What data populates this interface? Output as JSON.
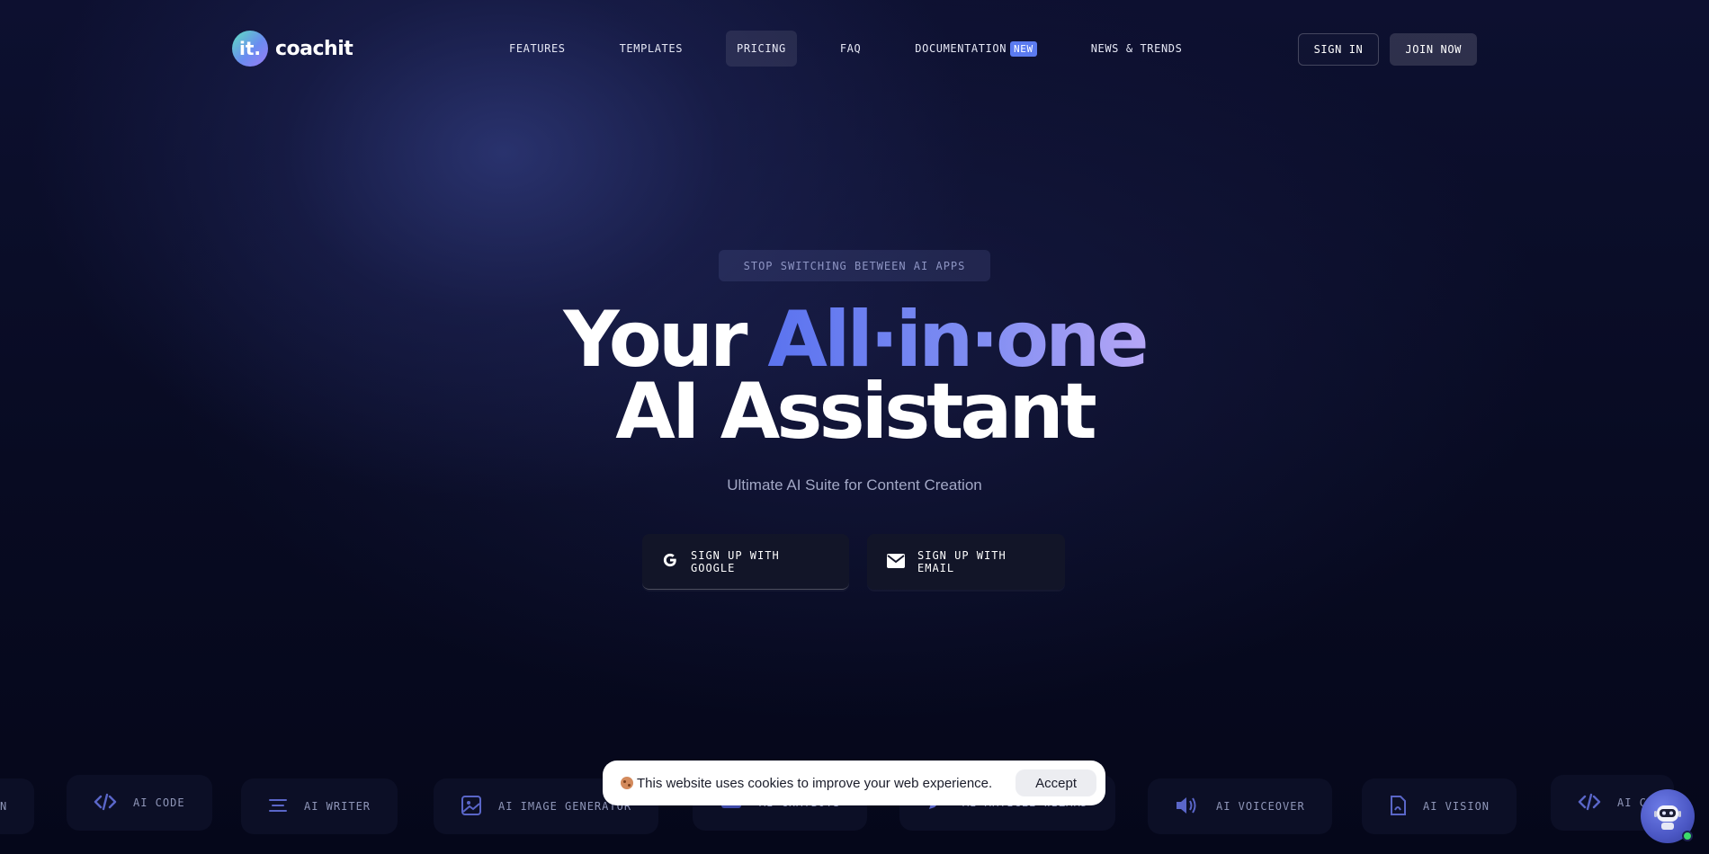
{
  "brand": {
    "logo_mark": "it.",
    "name": "coachit"
  },
  "nav": {
    "items": [
      {
        "label": "FEATURES"
      },
      {
        "label": "TEMPLATES"
      },
      {
        "label": "PRICING",
        "active": true
      },
      {
        "label": "FAQ"
      },
      {
        "label": "DOCUMENTATION",
        "badge": "NEW"
      },
      {
        "label": "NEWS & TRENDS"
      }
    ],
    "sign_in": "SIGN IN",
    "join_now": "JOIN NOW"
  },
  "hero": {
    "pill": "STOP SWITCHING BETWEEN AI APPS",
    "headline_prefix": "Your",
    "headline_accent": "All·in·one",
    "headline_line2": "AI Assistant",
    "subtitle": "Ultimate AI Suite for Content Creation",
    "cta_google": "SIGN UP WITH GOOGLE",
    "cta_email": "SIGN UP WITH EMAIL"
  },
  "features": [
    {
      "label": "N",
      "icon": "partial-icon"
    },
    {
      "label": "AI CODE",
      "icon": "code-icon"
    },
    {
      "label": "AI WRITER",
      "icon": "lines-icon"
    },
    {
      "label": "AI IMAGE GENERATOR",
      "icon": "image-icon"
    },
    {
      "label": "AI CHATBOTS",
      "icon": "chat-icon"
    },
    {
      "label": "AI ARTICLE WIZARD",
      "icon": "pen-icon"
    },
    {
      "label": "AI VOICEOVER",
      "icon": "speaker-icon"
    },
    {
      "label": "AI VISION",
      "icon": "document-icon"
    },
    {
      "label": "AI C",
      "icon": "code-icon"
    }
  ],
  "cookie": {
    "text": "This website uses cookies to improve your web experience.",
    "accept": "Accept"
  },
  "colors": {
    "accent": "#5b73ef",
    "badge": "#5b7bf0",
    "background": "#070a1c",
    "status_online": "#3ddc6a"
  }
}
